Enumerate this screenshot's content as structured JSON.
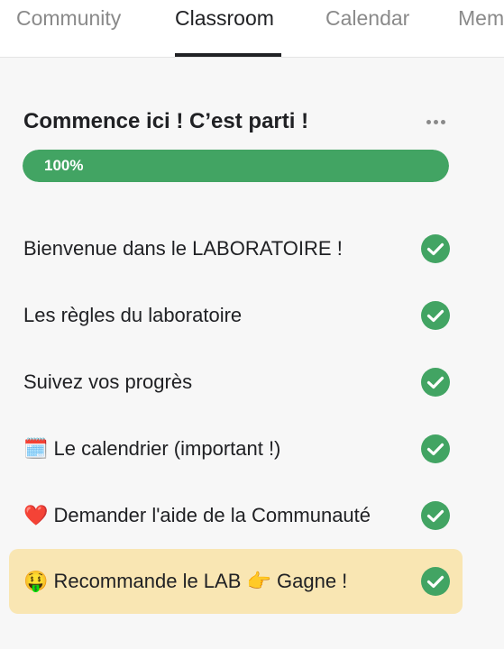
{
  "nav": {
    "tabs": [
      {
        "label": "Community"
      },
      {
        "label": "Classroom"
      },
      {
        "label": "Calendar"
      },
      {
        "label": "Mem"
      }
    ]
  },
  "course": {
    "title": "Commence ici ! C’est parti !",
    "progress_label": "100%",
    "progress_percent": 100
  },
  "lessons": [
    {
      "title": "Bienvenue dans le LABORATOIRE !",
      "completed": true
    },
    {
      "title": "Les règles du laboratoire",
      "completed": true
    },
    {
      "title": "Suivez vos progrès",
      "completed": true
    },
    {
      "title": "🗓️ Le calendrier (important !)",
      "completed": true
    },
    {
      "title": "❤️ Demander l'aide de la Communauté",
      "completed": true
    },
    {
      "title": "🤑 Recommande le LAB 👉 Gagne !",
      "completed": true
    }
  ],
  "colors": {
    "accent_green": "#42a463",
    "highlight_bg": "#f9e6b3"
  }
}
